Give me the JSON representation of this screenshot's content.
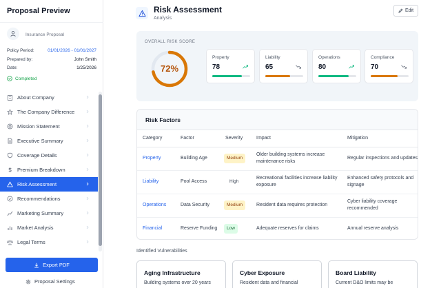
{
  "sidebar": {
    "title": "Proposal Preview",
    "subtitle": "Insurance Proposal",
    "meta": [
      {
        "key": "Policy Period:",
        "value": "01/01/2026 - 01/01/2027"
      },
      {
        "key": "Prepared by:",
        "value": "John Smith"
      },
      {
        "key": "Date:",
        "value": "1/25/2026"
      }
    ],
    "status": "Completed",
    "items": [
      {
        "label": "About Company",
        "icon": "building-icon"
      },
      {
        "label": "The Company Difference",
        "icon": "star-icon"
      },
      {
        "label": "Mission Statement",
        "icon": "target-icon"
      },
      {
        "label": "Executive Summary",
        "icon": "document-icon"
      },
      {
        "label": "Coverage Details",
        "icon": "shield-icon"
      },
      {
        "label": "Premium Breakdown",
        "icon": "dollar-icon"
      },
      {
        "label": "Risk Assessment",
        "icon": "warning-icon"
      },
      {
        "label": "Recommendations",
        "icon": "check-circle-icon"
      },
      {
        "label": "Marketing Summary",
        "icon": "chart-icon"
      },
      {
        "label": "Market Analysis",
        "icon": "bar-chart-icon"
      },
      {
        "label": "Legal Terms",
        "icon": "scale-icon"
      }
    ],
    "active_index": 6,
    "export_label": "Export PDF",
    "settings_label": "Proposal Settings"
  },
  "header": {
    "title": "Risk Assessment",
    "subtitle": "Analysis",
    "edit_label": "Edit"
  },
  "score": {
    "label": "OVERALL RISK SCORE",
    "value": 72,
    "display": "72%",
    "color": "#d97706",
    "metrics": [
      {
        "name": "Property",
        "value": 78,
        "trend": "up",
        "color": "#10b981"
      },
      {
        "name": "Liability",
        "value": 65,
        "trend": "down",
        "color": "#d97706"
      },
      {
        "name": "Operations",
        "value": 80,
        "trend": "up",
        "color": "#10b981"
      },
      {
        "name": "Compliance",
        "value": 70,
        "trend": "down",
        "color": "#d97706"
      }
    ]
  },
  "risk_factors": {
    "title": "Risk Factors",
    "columns": [
      "Category",
      "Factor",
      "Severity",
      "Impact",
      "Mitigation"
    ],
    "rows": [
      {
        "category": "Property",
        "factor": "Building Age",
        "severity": "Medium",
        "sev_class": "medium",
        "impact": "Older building systems increase maintenance risks",
        "mitigation": "Regular inspections and updates"
      },
      {
        "category": "Liability",
        "factor": "Pool Access",
        "severity": "High",
        "sev_class": "high",
        "impact": "Recreational facilities increase liability exposure",
        "mitigation": "Enhanced safety protocols and signage"
      },
      {
        "category": "Operations",
        "factor": "Data Security",
        "severity": "Medium",
        "sev_class": "medium",
        "impact": "Resident data requires protection",
        "mitigation": "Cyber liability coverage recommended"
      },
      {
        "category": "Financial",
        "factor": "Reserve Funding",
        "severity": "Low",
        "sev_class": "low",
        "impact": "Adequate reserves for claims",
        "mitigation": "Annual reserve analysis"
      }
    ]
  },
  "vulnerabilities": {
    "title": "Identified Vulnerabilities",
    "cards": [
      {
        "title": "Aging Infrastructure",
        "desc": "Building systems over 20 years"
      },
      {
        "title": "Cyber Exposure",
        "desc": "Resident data and financial"
      },
      {
        "title": "Board Liability",
        "desc": "Current D&O limits may be"
      }
    ]
  }
}
